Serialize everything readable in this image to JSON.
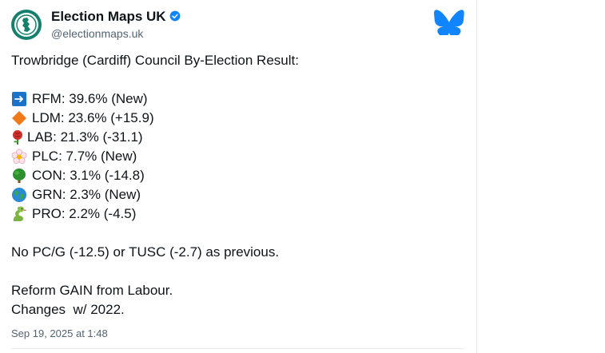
{
  "author": {
    "name": "Election Maps UK",
    "handle": "@electionmaps.uk",
    "verified": true
  },
  "post": {
    "headline": "Trowbridge (Cardiff) Council By-Election Result:",
    "results": [
      {
        "icon": "arrow-right-icon",
        "text": "RFM: 39.6% (New)"
      },
      {
        "icon": "orange-diamond-icon",
        "text": "LDM: 23.6% (+15.9)"
      },
      {
        "icon": "rose-icon",
        "text": "LAB: 21.3% (-31.1)"
      },
      {
        "icon": "blossom-icon",
        "text": "PLC: 7.7% (New)"
      },
      {
        "icon": "tree-icon",
        "text": "CON: 3.1% (-14.8)"
      },
      {
        "icon": "globe-icon",
        "text": "GRN: 2.3% (New)"
      },
      {
        "icon": "snake-icon",
        "text": "PRO: 2.2% (-4.5)"
      }
    ],
    "note": "No PC/G (-12.5) or TUSC (-2.7) as previous.",
    "outcome": "Reform GAIN from Labour.",
    "changes": "Changes  w/ 2022.",
    "timestamp": "Sep 19, 2025 at 1:48"
  },
  "colors": {
    "brand": "#1185fe",
    "avatar": "#15806e",
    "text": "#0f1419",
    "muted": "#536471"
  }
}
